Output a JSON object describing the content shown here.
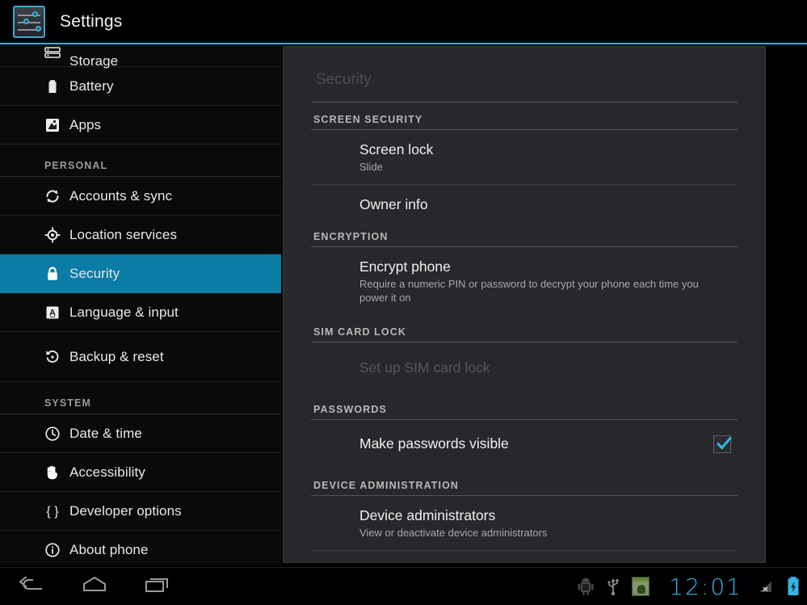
{
  "actionbar": {
    "icon_name": "settings-sliders-icon",
    "title": "Settings"
  },
  "colors": {
    "accent": "#33b5e5",
    "selected_item": "#0a7ca6",
    "dialog_bg": "#27282c",
    "sidebar_bg": "#0a0a0b",
    "checkbox_check": "#33b5e5",
    "clock": "#33b5e5"
  },
  "sidebar": {
    "items": [
      {
        "label": "Storage",
        "icon": "storage-icon",
        "type": "item",
        "selected": false,
        "clipped": true
      },
      {
        "label": "Battery",
        "icon": "battery-icon",
        "type": "item",
        "selected": false
      },
      {
        "label": "Apps",
        "icon": "apps-icon",
        "type": "item",
        "selected": false
      },
      {
        "label": "PERSONAL",
        "icon": "",
        "type": "header"
      },
      {
        "label": "Accounts & sync",
        "icon": "sync-icon",
        "type": "item",
        "selected": false
      },
      {
        "label": "Location services",
        "icon": "location-icon",
        "type": "item",
        "selected": false
      },
      {
        "label": "Security",
        "icon": "lock-icon",
        "type": "item",
        "selected": true
      },
      {
        "label": "Language & input",
        "icon": "language-icon",
        "type": "item",
        "selected": false
      },
      {
        "label": "Backup & reset",
        "icon": "backup-reset-icon",
        "type": "item",
        "selected": false
      },
      {
        "label": "SYSTEM",
        "icon": "",
        "type": "header"
      },
      {
        "label": "Date & time",
        "icon": "clock-icon",
        "type": "item",
        "selected": false
      },
      {
        "label": "Accessibility",
        "icon": "hand-icon",
        "type": "item",
        "selected": false
      },
      {
        "label": "Developer options",
        "icon": "braces-icon",
        "type": "item",
        "selected": false
      },
      {
        "label": "About phone",
        "icon": "info-icon",
        "type": "item",
        "selected": false
      }
    ]
  },
  "dialog": {
    "title": "Security",
    "sections": [
      {
        "header": "SCREEN SECURITY",
        "prefs": [
          {
            "title": "Screen lock",
            "summary": "Slide",
            "disabled": false,
            "checkbox": null
          },
          {
            "title": "Owner info",
            "summary": "",
            "disabled": false,
            "checkbox": null
          }
        ]
      },
      {
        "header": "ENCRYPTION",
        "prefs": [
          {
            "title": "Encrypt phone",
            "summary": "Require a numeric PIN or password to decrypt your phone each time you power it on",
            "disabled": false,
            "checkbox": null
          }
        ]
      },
      {
        "header": "SIM CARD LOCK",
        "prefs": [
          {
            "title": "Set up SIM card lock",
            "summary": "",
            "disabled": true,
            "checkbox": null
          }
        ]
      },
      {
        "header": "PASSWORDS",
        "prefs": [
          {
            "title": "Make passwords visible",
            "summary": "",
            "disabled": false,
            "checkbox": true
          }
        ]
      },
      {
        "header": "DEVICE ADMINISTRATION",
        "prefs": [
          {
            "title": "Device administrators",
            "summary": "View or deactivate device administrators",
            "disabled": false,
            "checkbox": null
          }
        ]
      }
    ]
  },
  "systembar": {
    "nav": [
      {
        "name": "back-button",
        "icon": "back-arrow-icon"
      },
      {
        "name": "home-button",
        "icon": "home-icon"
      },
      {
        "name": "recents-button",
        "icon": "recents-icon"
      }
    ],
    "status_icons": [
      {
        "name": "android-debug-icon"
      },
      {
        "name": "usb-icon"
      },
      {
        "name": "app-notification-icon"
      }
    ],
    "clock": "12:01",
    "signal": {
      "name": "no-signal-icon",
      "label": "x"
    },
    "battery": {
      "name": "battery-charging-icon"
    }
  }
}
